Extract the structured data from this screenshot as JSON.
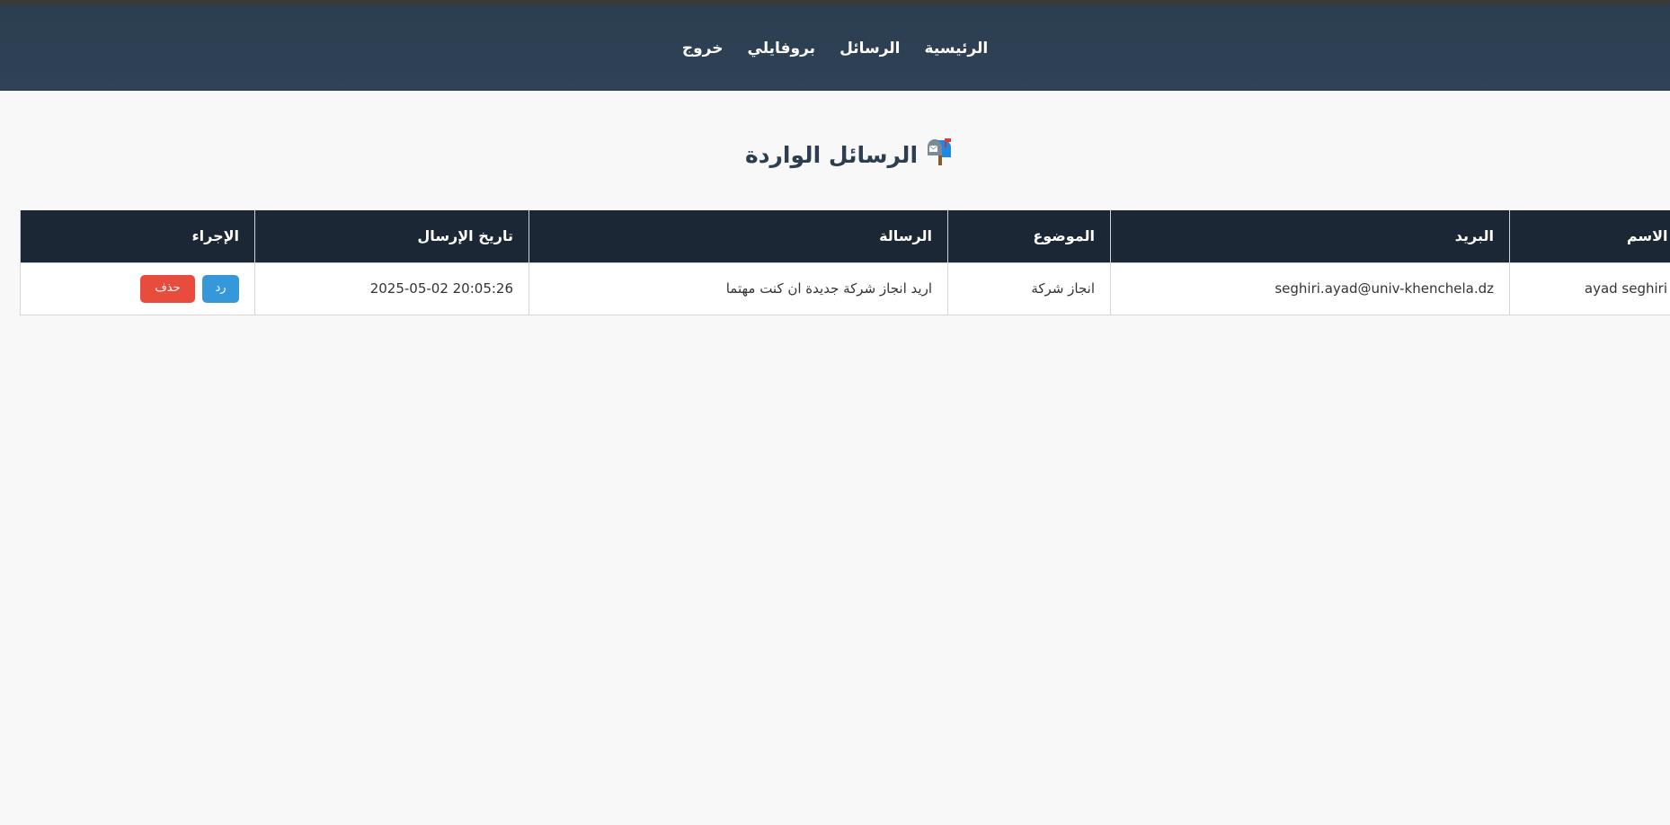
{
  "nav": {
    "home": "الرئيسية",
    "messages": "الرسائل",
    "profile": "بروفايلي",
    "logout": "خروج"
  },
  "page": {
    "title": "الرسائل الواردة",
    "title_icon": "mailbox-icon"
  },
  "table": {
    "headers": {
      "name": "الاسم",
      "email": "البريد",
      "subject": "الموضوع",
      "message": "الرسالة",
      "date": "تاريخ الإرسال",
      "action": "الإجراء"
    },
    "rows": [
      {
        "name": "ayad seghiri",
        "email": "seghiri.ayad@univ-khenchela.dz",
        "subject": "انجاز شركة",
        "message": "اريد انجاز شركة جديدة ان كنت مهتما",
        "date": "2025-05-02 20:05:26",
        "reply_label": "رد",
        "delete_label": "حذف"
      }
    ]
  },
  "colors": {
    "navbar": "#2c3e50",
    "table_header": "#1c2735",
    "reply_button": "#3498db",
    "delete_button": "#e74c3c",
    "background": "#f8f8f8"
  }
}
